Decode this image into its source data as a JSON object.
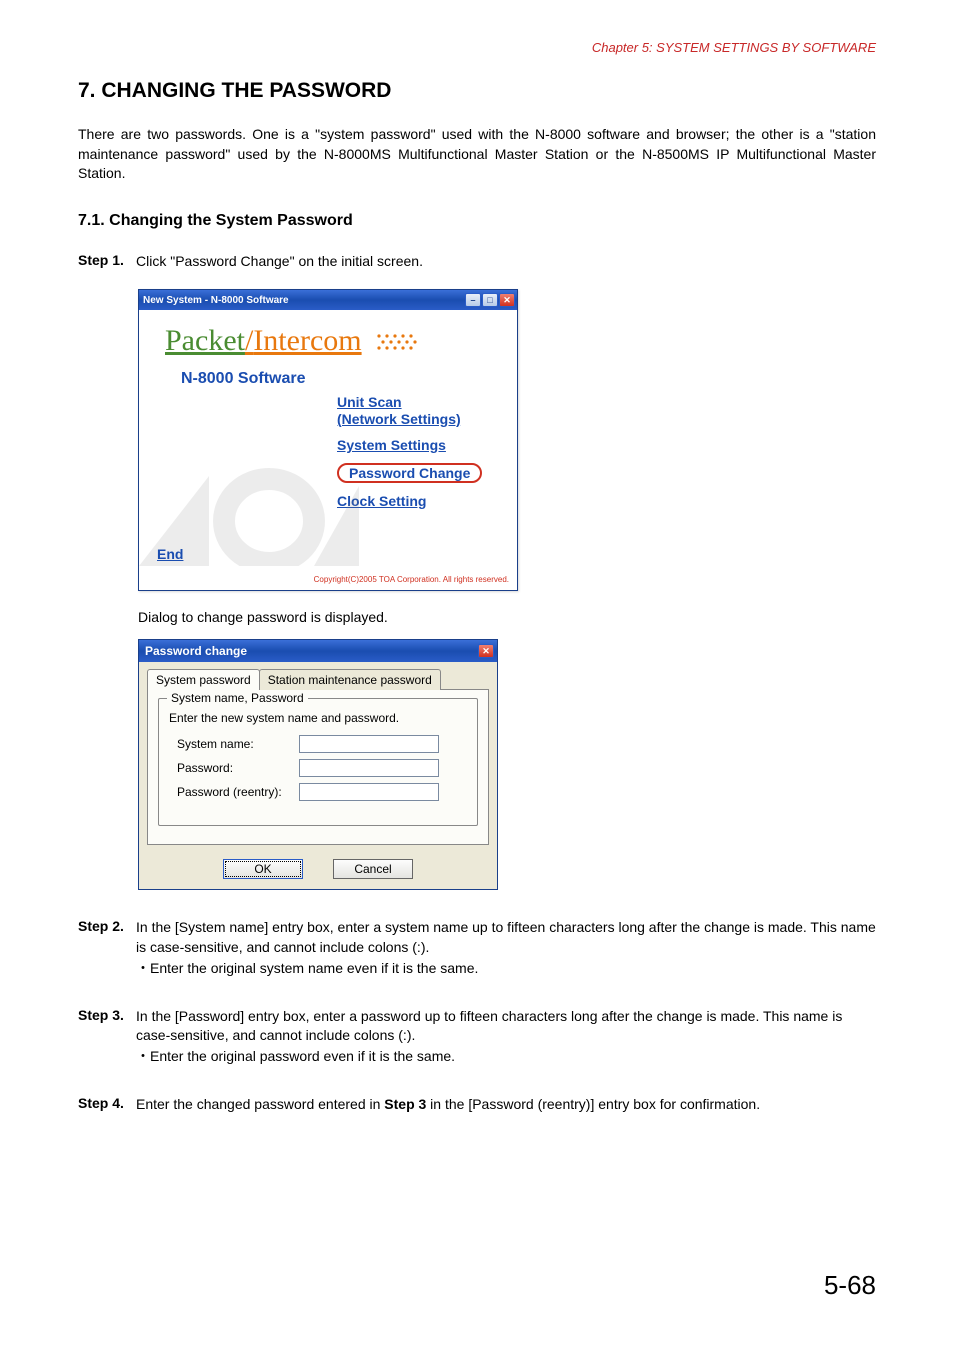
{
  "chapter_header": "Chapter 5:  SYSTEM SETTINGS BY SOFTWARE",
  "section_title": "7. CHANGING THE PASSWORD",
  "intro_text": "There are two passwords. One is a \"system password\" used with the N-8000 software and browser; the other is a \"station maintenance password\" used by the N-8000MS Multifunctional Master Station or the N-8500MS IP Multifunctional Master Station.",
  "subsection_title": "7.1. Changing the System Password",
  "step1": {
    "label": "Step 1.",
    "text": "Click \"Password Change\" on the initial screen."
  },
  "win1": {
    "title": "New System - N-8000 Software",
    "logo_part1": "Packet",
    "logo_part2": "Intercom",
    "software_label": "N-8000 Software",
    "menu": {
      "unit_scan": "Unit Scan",
      "network_settings": "(Network Settings)",
      "system_settings": "System Settings",
      "password_change": "Password Change",
      "clock_setting": "Clock Setting"
    },
    "end": "End",
    "copyright": "Copyright(C)2005 TOA Corporation. All rights reserved."
  },
  "dialog_caption": "Dialog to change password is displayed.",
  "win2": {
    "title": "Password change",
    "tab1": "System password",
    "tab2": "Station maintenance password",
    "group_title": "System name, Password",
    "group_text": "Enter the new system name and password.",
    "field_system_name": "System name:",
    "field_password": "Password:",
    "field_reentry": "Password (reentry):",
    "ok": "OK",
    "cancel": "Cancel"
  },
  "step2": {
    "label": "Step 2.",
    "text": "In the [System name] entry box, enter a system name up to fifteen characters long after the change is made. This name is case-sensitive, and cannot include colons (:).",
    "bullet": "・Enter the original system name even if it is the same."
  },
  "step3": {
    "label": "Step 3.",
    "text": "In the [Password] entry box, enter a password up to fifteen characters long after the change is made. This name is case-sensitive, and cannot include colons (:).",
    "bullet": "・Enter the original password even if it is the same."
  },
  "step4": {
    "label": "Step 4.",
    "text_before": "Enter the changed password entered in ",
    "bold": "Step 3",
    "text_after": " in the [Password (reentry)] entry box for confirmation."
  },
  "page_number": "5-68"
}
